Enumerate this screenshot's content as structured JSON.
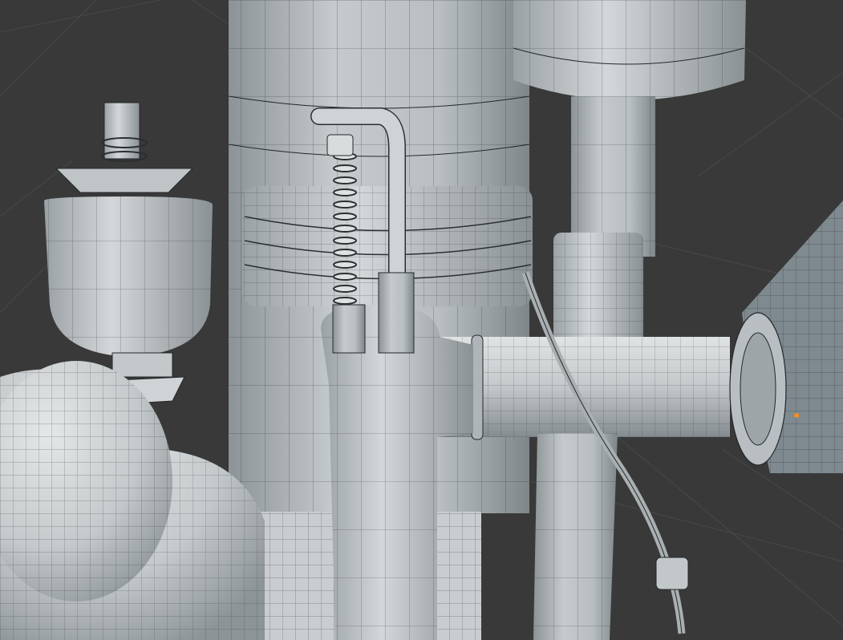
{
  "viewport": {
    "mode": "solid-wireframe",
    "background_color": "#393939",
    "grid_color": "#4a4a4a",
    "mesh_color": "#c9cdcf",
    "mesh_shadow_color": "#7b8285",
    "wire_color": "#1e2224",
    "selection_origin_color": "#ff8c1a"
  },
  "scene": {
    "objects": [
      "tall-tank",
      "top-right-canister",
      "vertical-pipe",
      "horizontal-pipe",
      "flange",
      "left-cup-valve",
      "spring-rod",
      "bent-rod",
      "t-junction",
      "dome-housing",
      "base-block",
      "right-panel",
      "lower-pipe",
      "cable"
    ]
  }
}
